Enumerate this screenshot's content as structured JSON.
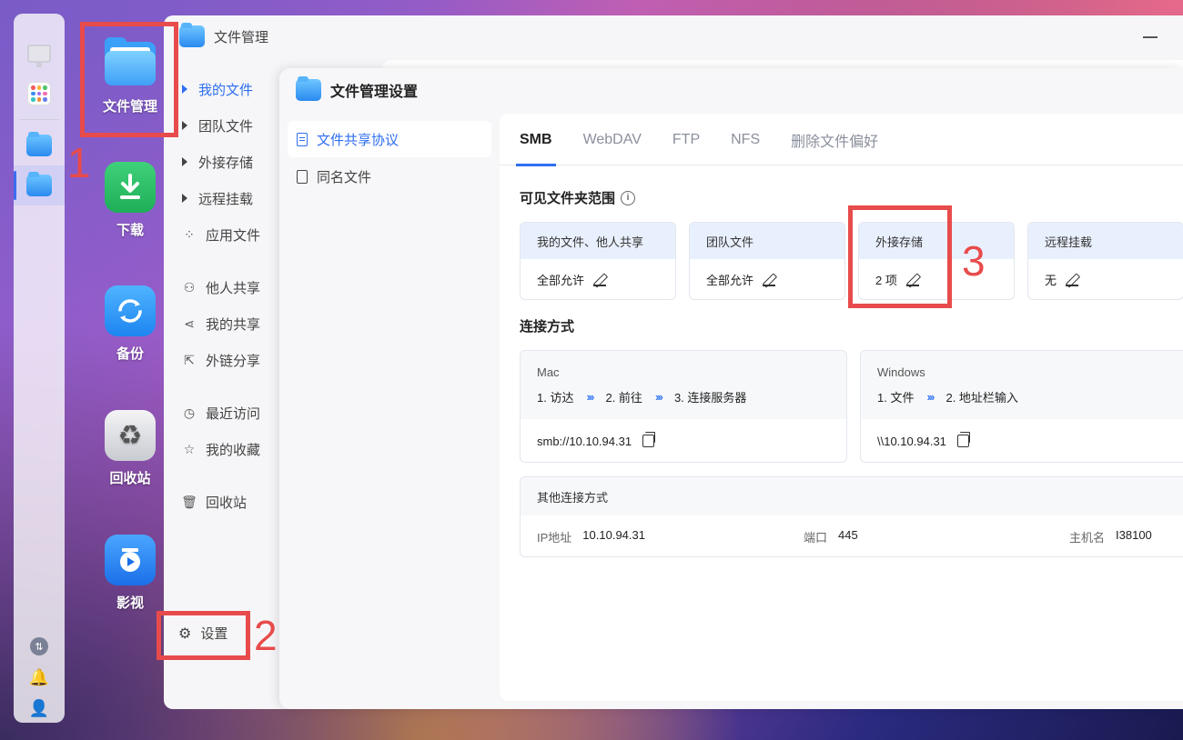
{
  "desktop": {
    "icons": [
      {
        "label": "文件管理"
      },
      {
        "label": "下载"
      },
      {
        "label": "备份"
      },
      {
        "label": "回收站"
      },
      {
        "label": "影视"
      }
    ]
  },
  "annotations": {
    "n1": "1",
    "n2": "2",
    "n3": "3"
  },
  "window": {
    "title": "文件管理",
    "nav": {
      "my_files": "我的文件",
      "team_files": "团队文件",
      "external": "外接存储",
      "remote": "远程挂载",
      "app_files": "应用文件",
      "shared_with_me": "他人共享",
      "my_shares": "我的共享",
      "link_shares": "外链分享",
      "recent": "最近访问",
      "favorites": "我的收藏",
      "recycle": "回收站"
    },
    "settings_label": "设置"
  },
  "dialog": {
    "title": "文件管理设置",
    "nav": [
      "文件共享协议",
      "同名文件"
    ],
    "tabs": [
      "SMB",
      "WebDAV",
      "FTP",
      "NFS",
      "删除文件偏好"
    ],
    "visible_scope": {
      "title": "可见文件夹范围",
      "cards": [
        {
          "head": "我的文件、他人共享",
          "value": "全部允许"
        },
        {
          "head": "团队文件",
          "value": "全部允许"
        },
        {
          "head": "外接存储",
          "value": "2 项"
        },
        {
          "head": "远程挂载",
          "value": "无"
        }
      ]
    },
    "connect": {
      "title": "连接方式",
      "mac": {
        "os": "Mac",
        "step1": "1. 访达",
        "step2": "2. 前往",
        "step3": "3. 连接服务器",
        "address": "smb://10.10.94.31"
      },
      "windows": {
        "os": "Windows",
        "step1": "1. 文件",
        "step2": "2. 地址栏输入",
        "address": "\\\\10.10.94.31"
      },
      "arrows": "›››"
    },
    "other": {
      "title": "其他连接方式",
      "ip_label": "IP地址",
      "ip_value": "10.10.94.31",
      "port_label": "端口",
      "port_value": "445",
      "host_label": "主机名",
      "host_value": "I38100"
    }
  },
  "colors": {
    "accent": "#2f6ff2",
    "annotation": "#e84b4b"
  }
}
